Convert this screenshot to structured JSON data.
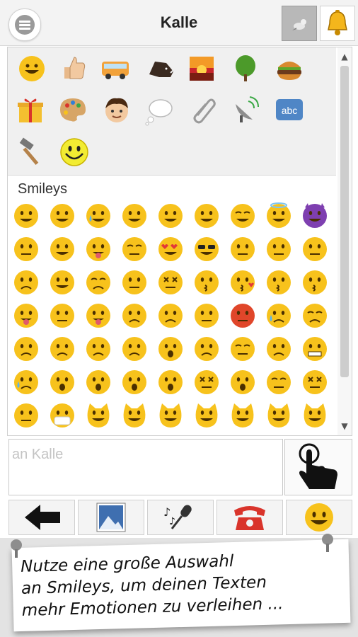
{
  "header": {
    "title": "Kalle"
  },
  "emoji_panel": {
    "section_label": "Smileys",
    "category_icons": [
      "smiley",
      "thumbs-up",
      "bus",
      "boar",
      "sunset",
      "tree",
      "hamburger",
      "gift",
      "palette",
      "boy-face",
      "thought-bubble",
      "paperclip",
      "satellite-dish",
      "abc-symbol",
      "hammer",
      "smiley-classic"
    ]
  },
  "composer": {
    "placeholder": "an Kalle"
  },
  "toolbar": {
    "items": [
      "back-arrow",
      "image",
      "microphone",
      "telephone",
      "smiley"
    ]
  },
  "promo": {
    "line1": "Nutze eine große Auswahl",
    "line2": "an Smileys, um deinen Texten",
    "line3": "mehr Emotionen zu verleihen ..."
  },
  "colors": {
    "emoji_yellow": "#f7c21c",
    "header_bg": "#f3f3f3",
    "accent_red": "#d9342b"
  }
}
